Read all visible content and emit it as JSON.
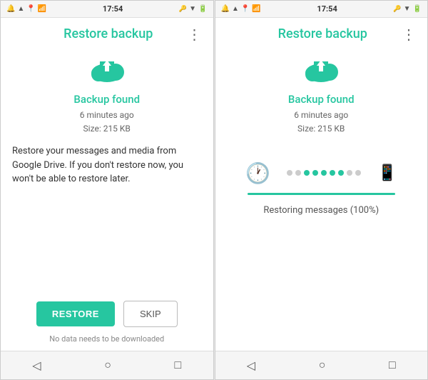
{
  "left_phone": {
    "status_bar": {
      "time": "17:54",
      "icons_left": [
        "notification",
        "wifi",
        "location",
        "signal"
      ],
      "icons_right": [
        "lock",
        "wifi_signal",
        "battery"
      ]
    },
    "header": {
      "title": "Restore backup",
      "menu_icon": "⋮"
    },
    "backup_found_label": "Backup found",
    "backup_time": "6 minutes ago",
    "backup_size": "Size: 215 KB",
    "description": "Restore your messages and media from Google Drive. If you don't restore now, you won't be able to restore later.",
    "restore_button": "RESTORE",
    "skip_button": "SKIP",
    "no_download_text": "No data needs to be downloaded"
  },
  "right_phone": {
    "status_bar": {
      "time": "17:54",
      "icons_left": [
        "notification",
        "wifi",
        "location",
        "signal"
      ],
      "icons_right": [
        "lock",
        "wifi_signal",
        "battery"
      ]
    },
    "header": {
      "title": "Restore backup",
      "menu_icon": "⋮"
    },
    "backup_found_label": "Backup found",
    "backup_time": "6 minutes ago",
    "backup_size": "Size: 215 KB",
    "progress": {
      "dots": [
        {
          "active": false
        },
        {
          "active": false
        },
        {
          "active": true
        },
        {
          "active": true
        },
        {
          "active": true
        },
        {
          "active": true
        },
        {
          "active": true
        },
        {
          "active": false
        },
        {
          "active": false
        }
      ],
      "fill_percent": 100
    },
    "restoring_text": "Restoring messages (100%)"
  },
  "bottom_nav": {
    "back_label": "◁",
    "home_label": "○",
    "recent_label": "□"
  }
}
